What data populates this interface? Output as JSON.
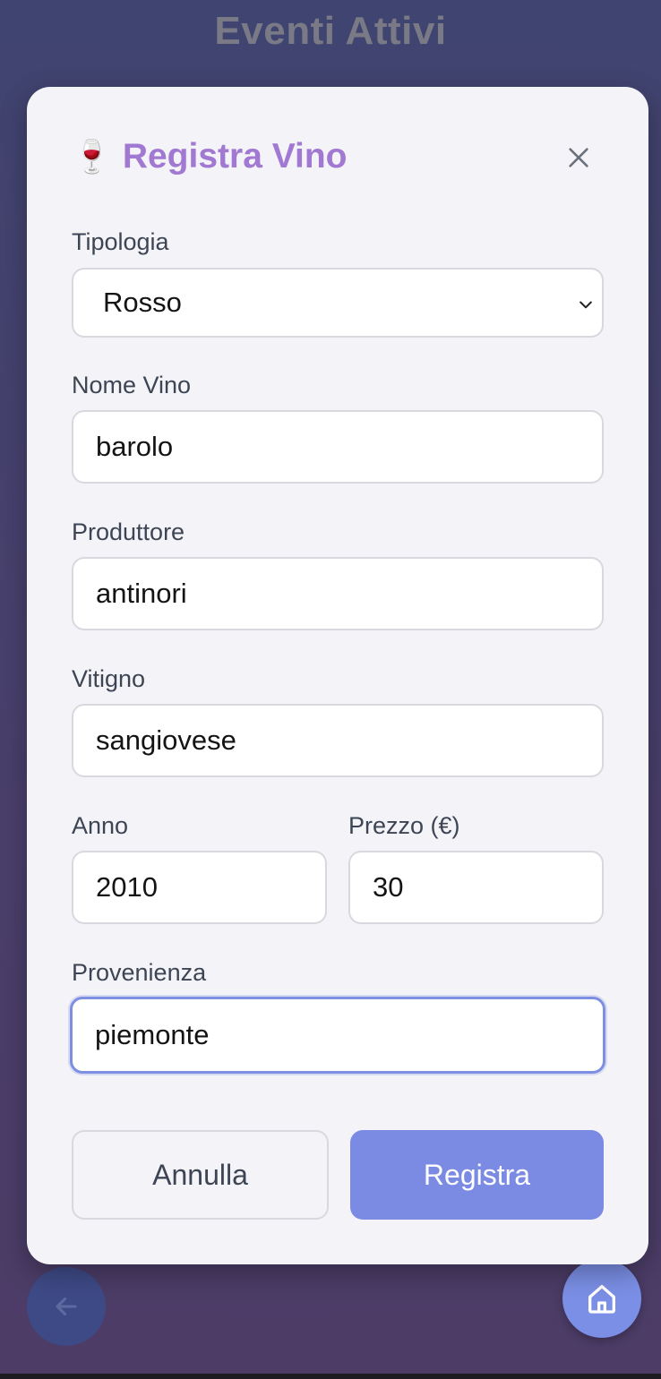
{
  "background": {
    "title": "Eventi Attivi"
  },
  "modal": {
    "icon": "🍷",
    "icon_name": "wine-glass-icon",
    "title": "Registra Vino",
    "close_icon": "close-icon",
    "fields": {
      "tipologia": {
        "label": "Tipologia",
        "value": "Rosso",
        "options_visible": [
          "Rosso"
        ]
      },
      "nome_vino": {
        "label": "Nome Vino",
        "value": "barolo"
      },
      "produttore": {
        "label": "Produttore",
        "value": "antinori"
      },
      "vitigno": {
        "label": "Vitigno",
        "value": "sangiovese"
      },
      "anno": {
        "label": "Anno",
        "value": "2010"
      },
      "prezzo": {
        "label": "Prezzo (€)",
        "value": "30"
      },
      "provenienza": {
        "label": "Provenienza",
        "value": "piemonte",
        "focused": true
      }
    },
    "buttons": {
      "cancel_label": "Annulla",
      "submit_label": "Registra"
    }
  },
  "footer": {
    "back_icon": "arrow-left-icon",
    "home_icon": "home-icon"
  },
  "colors": {
    "accent": "#7b8be3",
    "title": "#a178d2",
    "focus_border": "#7e8ee0"
  }
}
